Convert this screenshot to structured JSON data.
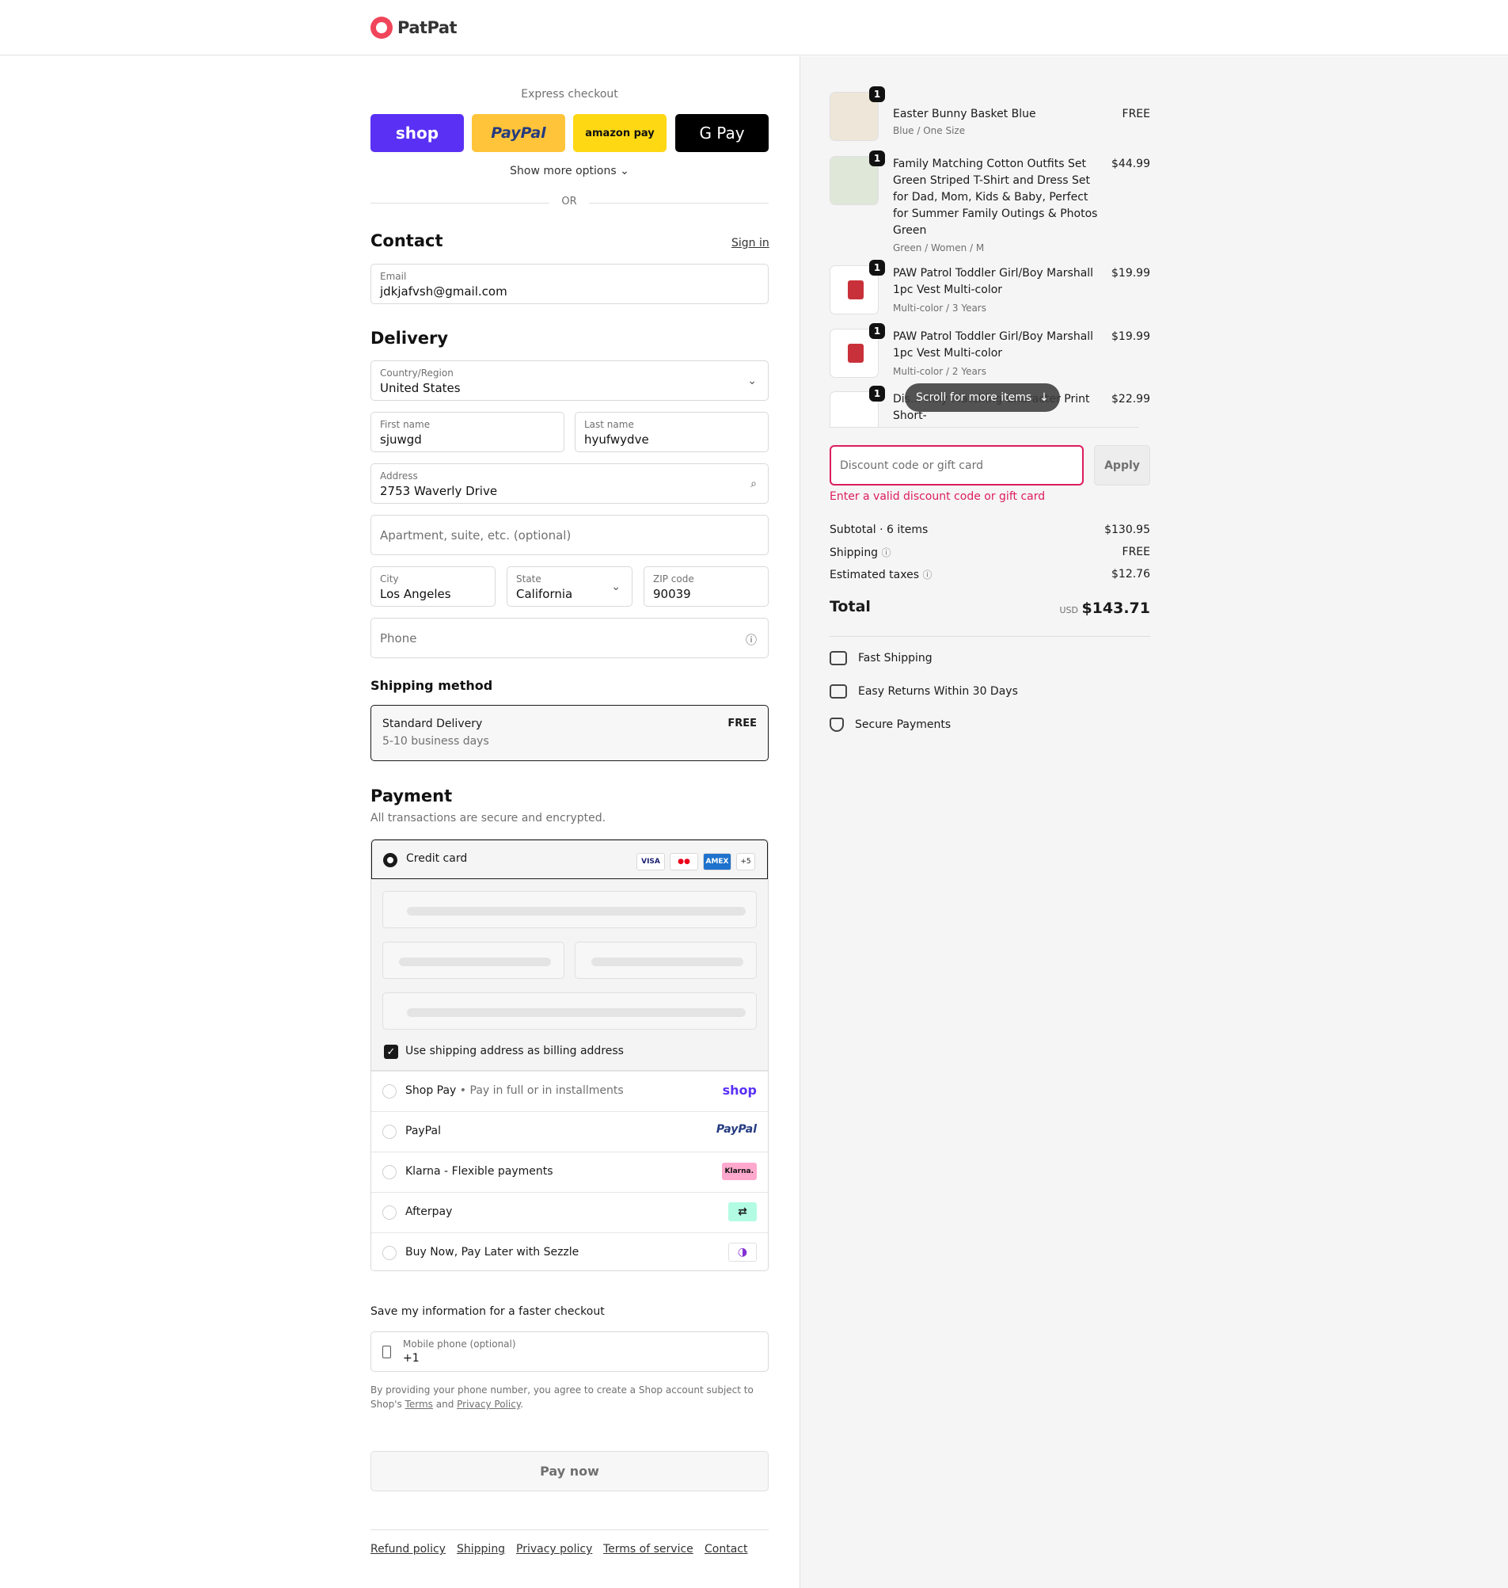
{
  "brand": {
    "name": "PatPat"
  },
  "express": {
    "title": "Express checkout",
    "buttons": [
      "shop",
      "PayPal",
      "amazon pay",
      "G Pay"
    ],
    "show_more": "Show more options",
    "or": "OR"
  },
  "contact": {
    "heading": "Contact",
    "sign_in": "Sign in",
    "email_label": "Email",
    "email_value": "jdkjafvsh@gmail.com"
  },
  "delivery": {
    "heading": "Delivery",
    "country_label": "Country/Region",
    "country_value": "United States",
    "first_name_label": "First name",
    "first_name_value": "sjuwgd",
    "last_name_label": "Last name",
    "last_name_value": "hyufwydve",
    "address_label": "Address",
    "address_value": "2753 Waverly Drive",
    "apartment_placeholder": "Apartment, suite, etc. (optional)",
    "city_label": "City",
    "city_value": "Los Angeles",
    "state_label": "State",
    "state_value": "California",
    "zip_label": "ZIP code",
    "zip_value": "90039",
    "phone_placeholder": "Phone"
  },
  "shipping_method": {
    "heading": "Shipping method",
    "name": "Standard Delivery",
    "eta": "5-10 business days",
    "price": "FREE"
  },
  "payment": {
    "heading": "Payment",
    "subtitle": "All transactions are secure and encrypted.",
    "credit_card": "Credit card",
    "card_logos": [
      "VISA",
      "MC",
      "AMEX",
      "+5"
    ],
    "billing_same": "Use shipping address as billing address",
    "options": [
      {
        "label": "Shop Pay",
        "sub": "Pay in full or in installments",
        "logo": "shop"
      },
      {
        "label": "PayPal",
        "sub": "",
        "logo": "PayPal"
      },
      {
        "label": "Klarna - Flexible payments",
        "sub": "",
        "logo": "Klarna."
      },
      {
        "label": "Afterpay",
        "sub": "",
        "logo": "afterpay-icon"
      },
      {
        "label": "Buy Now, Pay Later with Sezzle",
        "sub": "",
        "logo": "sezzle-icon"
      }
    ]
  },
  "save_info": {
    "heading": "Save my information for a faster checkout",
    "mobile_label": "Mobile phone (optional)",
    "mobile_value": "+1",
    "legal_1": "By providing your phone number, you agree to create a Shop account subject to",
    "legal_2a": "Shop's",
    "terms": "Terms",
    "and": "and",
    "privacy": "Privacy Policy"
  },
  "pay_now": "Pay now",
  "footer_links": [
    "Refund policy",
    "Shipping",
    "Privacy policy",
    "Terms of service",
    "Contact"
  ],
  "cart": {
    "items": [
      {
        "qty": "1",
        "name": "Easter Bunny Basket Blue",
        "variant": "Blue / One Size",
        "price": "FREE"
      },
      {
        "qty": "1",
        "name": "Family Matching Cotton Outfits Set Green Striped T-Shirt and Dress Set for Dad, Mom, Kids & Baby, Perfect for Summer Family Outings & Photos Green",
        "variant": "Green / Women / M",
        "price": "$44.99"
      },
      {
        "qty": "1",
        "name": "PAW Patrol Toddler Girl/Boy Marshall 1pc Vest Multi-color",
        "variant": "Multi-color / 3 Years",
        "price": "$19.99"
      },
      {
        "qty": "1",
        "name": "PAW Patrol Toddler Girl/Boy Marshall 1pc Vest Multi-color",
        "variant": "Multi-color / 2 Years",
        "price": "$19.99"
      },
      {
        "qty": "1",
        "name": "Dis... mily Matching Character Print Short-",
        "variant": "",
        "price": "$22.99"
      }
    ],
    "scroll_hint": "Scroll for more items",
    "discount_placeholder": "Discount code or gift card",
    "apply": "Apply",
    "discount_error": "Enter a valid discount code or gift card",
    "subtotal_label": "Subtotal · 6 items",
    "subtotal": "$130.95",
    "shipping_label": "Shipping",
    "shipping": "FREE",
    "taxes_label": "Estimated taxes",
    "taxes": "$12.76",
    "total_label": "Total",
    "currency": "USD",
    "total": "$143.71"
  },
  "perks": [
    "Fast Shipping",
    "Easy Returns Within 30 Days",
    "Secure Payments"
  ],
  "colors": {
    "shop": "#5a31f4",
    "paypal": "#ffc439",
    "amazon": "#ffd814",
    "gpay": "#000000",
    "error": "#dd1d5b"
  }
}
